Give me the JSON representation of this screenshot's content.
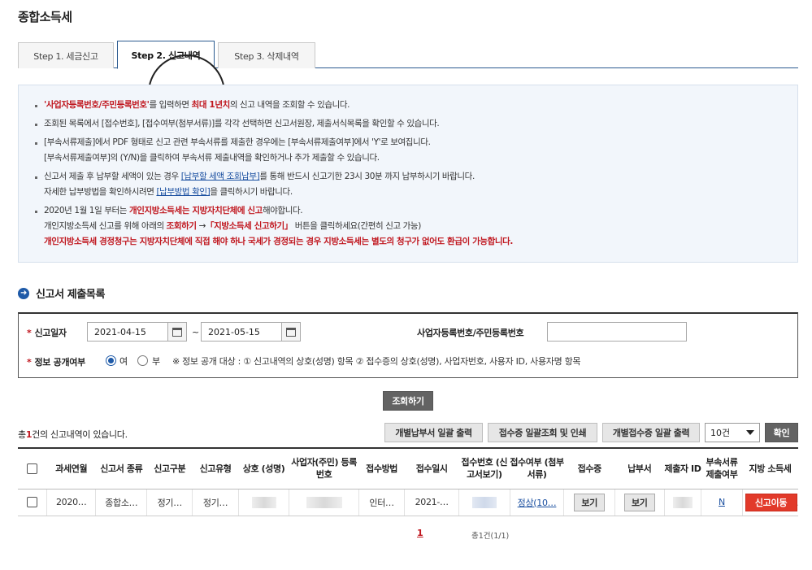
{
  "page_title": "종합소득세",
  "tabs": [
    {
      "label": "Step 1. 세금신고"
    },
    {
      "label": "Step 2. 신고내역"
    },
    {
      "label": "Step 3. 삭제내역"
    }
  ],
  "notice": {
    "item1_red": "'사업자등록번호/주민등록번호'",
    "item1_mid": "를 입력하면 ",
    "item1_red2": "최대 1년치",
    "item1_end": "의 신고 내역을 조회할 수 있습니다.",
    "item2": "조회된 목록에서 [접수번호], [접수여부(첨부서류)]를 각각 선택하면 신고서원장, 제출서식목록을 확인할 수 있습니다.",
    "item3_line1": "[부속서류제출]에서 PDF 형태로 신고 관련 부속서류를 제출한 경우에는 [부속서류제출여부]에서 'Y'로 보여집니다.",
    "item3_line2": "[부속서류제출여부]의 (Y/N)을 클릭하여 부속서류 제출내역을 확인하거나 추가 제출할 수 있습니다.",
    "item4_a": "신고서 제출 후 납부할 세액이 있는 경우 ",
    "item4_link": "[납부할 세액 조회납부]",
    "item4_b": "를 통해 반드시 신고기한 23시 30분 까지 납부하시기 바랍니다.",
    "item4_c": "자세한 납부방법을 확인하시려면 ",
    "item4_link2": "[납부방법 확인]",
    "item4_d": "을 클릭하시기 바랍니다.",
    "item5_a": "2020년 1월 1일 부터는 ",
    "item5_red": "개인지방소득세는 지방자치단체에 신고",
    "item5_b": "해야합니다.",
    "item5_c": "개인지방소득세 신고를 위해 아래의 ",
    "item5_red2": "조회하기",
    "item5_arrow": " →",
    "item5_red3": "「지방소득세 신고하기」",
    "item5_d": " 버튼을 클릭하세요(간편히 신고 가능)",
    "item5_red4": "개인지방소득세 경정청구는 지방자치단체에 직접 해야 하나 국세가 경정되는 경우 지방소득세는 별도의 청구가 없어도 환급이 가능합니다."
  },
  "section_title": "신고서 제출목록",
  "search": {
    "date_label": "신고일자",
    "date_from": "2021-04-15",
    "tilde": "~",
    "date_to": "2021-05-15",
    "id_label": "사업자등록번호/주민등록번호",
    "id_value": "",
    "disclose_label": "정보 공개여부",
    "opt_yes": "여",
    "opt_no": "부",
    "disclose_note": "※ 정보 공개 대상 : ① 신고내역의 상호(성명) 항목 ② 접수증의 상호(성명), 사업자번호, 사용자 ID, 사용자명 항목"
  },
  "search_button": "조회하기",
  "result": {
    "count_prefix": "총",
    "count": "1",
    "count_suffix": "건의 신고내역이 있습니다."
  },
  "actions": {
    "bulk_pay": "개별납부서 일괄 출력",
    "bulk_receipt": "접수증 일괄조회 및 인쇄",
    "bulk_receipt_print": "개별접수증 일괄 출력",
    "page_size": "10건",
    "confirm": "확인"
  },
  "table": {
    "headers": [
      "과세연월",
      "신고서 종류",
      "신고구분",
      "신고유형",
      "상호 (성명)",
      "사업자(주민) 등록번호",
      "접수방법",
      "접수일시",
      "접수번호 (신고서보기)",
      "접수여부 (첨부서류)",
      "접수증",
      "납부서",
      "제출자 ID",
      "부속서류 제출여부",
      "지방 소득세"
    ],
    "row": {
      "period": "2020…",
      "form": "종합소…",
      "category": "정기…",
      "type": "정기…",
      "method": "인터…",
      "datetime": "2021-…",
      "status": "정상(10…",
      "receipt": "보기",
      "payment": "보기",
      "attach": "N",
      "local_tax": "신고이동"
    }
  },
  "pagination": {
    "current": "1",
    "total": "총1건(1/1)"
  }
}
